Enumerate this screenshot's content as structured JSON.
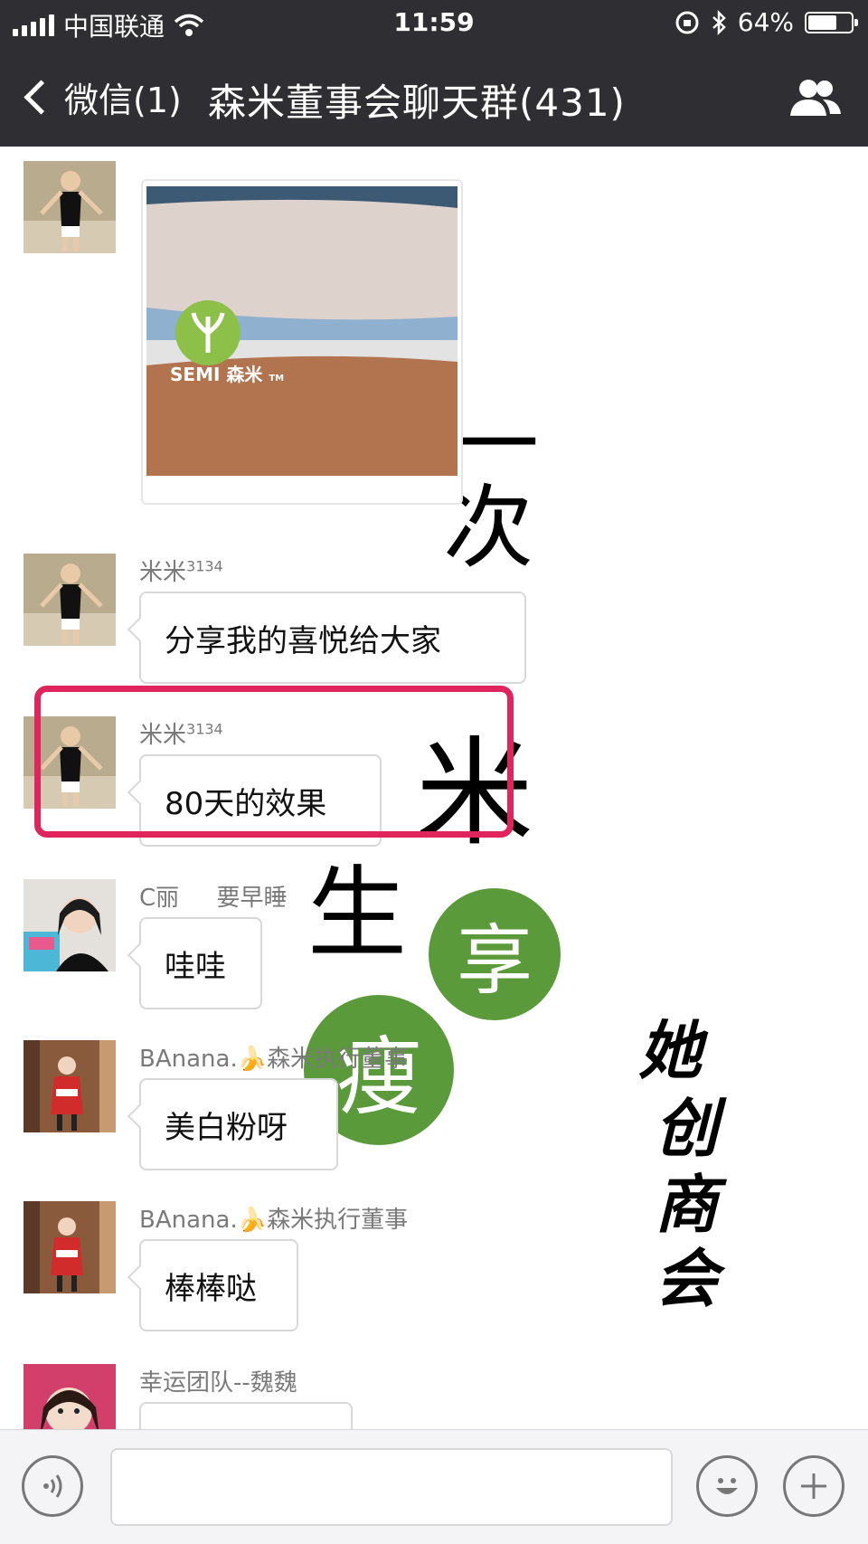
{
  "status_bar": {
    "carrier": "中国联通",
    "time": "11:59",
    "battery": "64%",
    "battery_level": 0.64
  },
  "nav": {
    "back_label": "微信(1)",
    "title": "森米董事会聊天群(431)"
  },
  "image_message": {
    "brand": "SEMI 森米",
    "tm": "TM"
  },
  "poster": {
    "chars": [
      "一",
      "次",
      "米",
      "生"
    ],
    "circle_chars": [
      "享",
      "瘦"
    ],
    "calligraphy": [
      "她",
      "创",
      "商",
      "会"
    ]
  },
  "messages": [
    {
      "sender": "米米",
      "sender_sup": "3134",
      "text": "分享我的喜悦给大家"
    },
    {
      "sender": "米米",
      "sender_sup": "3134",
      "text": "80天的效果"
    },
    {
      "sender": "C丽",
      "sender_extra": "要早睡",
      "text": "哇哇"
    },
    {
      "sender": "BAnana.🍌森米执行董事",
      "text": "美白粉呀"
    },
    {
      "sender": "BAnana.🍌森米执行董事",
      "text": "棒棒哒"
    },
    {
      "sender": "幸运团队--魏魏",
      "text": ""
    }
  ],
  "input": {
    "voice_icon": "voice-icon",
    "emoji_icon": "emoji-icon",
    "plus_icon": "plus-icon"
  },
  "colors": {
    "header_bg": "#2e2e33",
    "highlight": "#e0245e",
    "brand_green": "#5b9a3a"
  }
}
